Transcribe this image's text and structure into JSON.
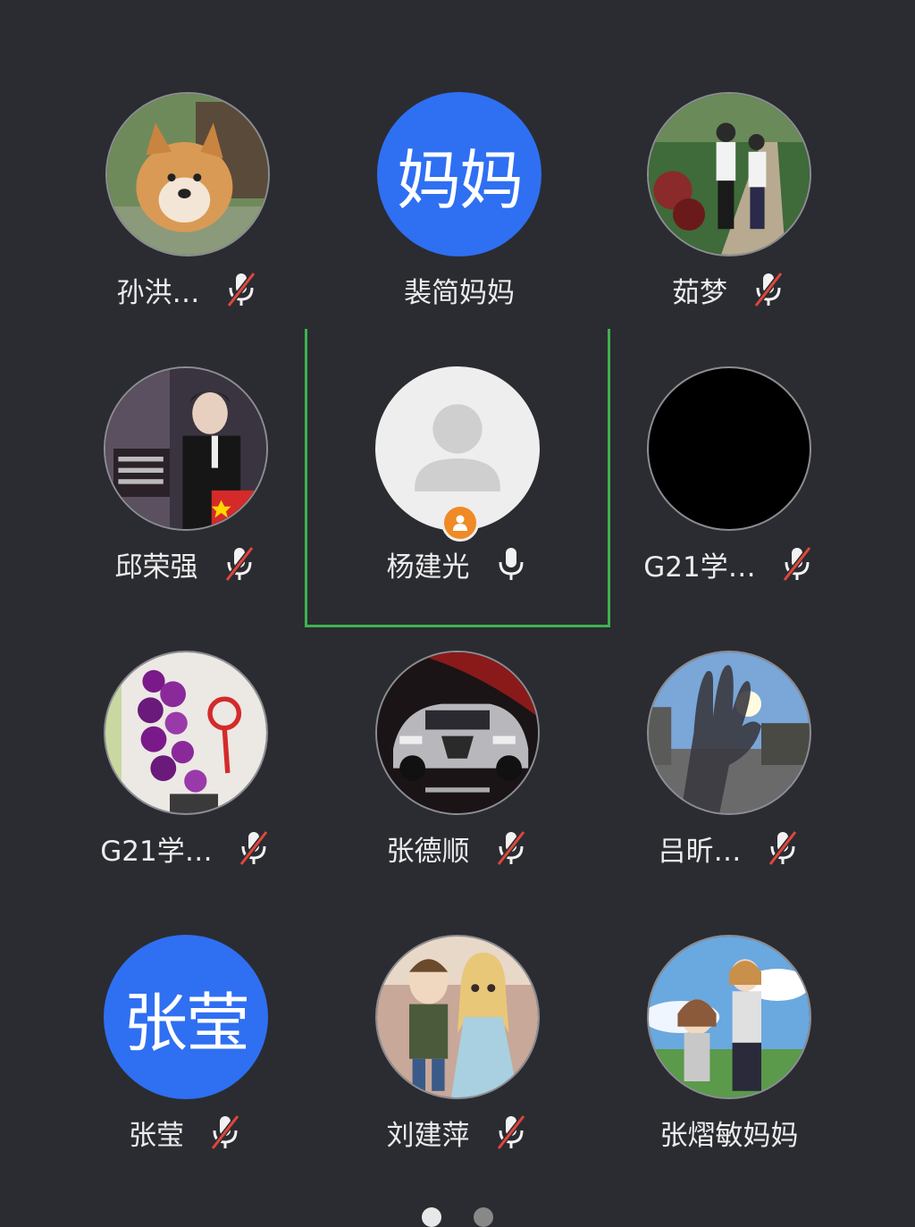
{
  "participants": [
    {
      "name": "孙洪…",
      "avatar_type": "photo",
      "avatar_subject": "dog",
      "muted": true
    },
    {
      "name": "裴简妈妈",
      "avatar_type": "text",
      "avatar_text": "妈妈",
      "muted": null
    },
    {
      "name": "茹梦",
      "avatar_type": "photo",
      "avatar_subject": "two-people-walking",
      "muted": true
    },
    {
      "name": "邱荣强",
      "avatar_type": "photo",
      "avatar_subject": "man-in-suit",
      "muted": true
    },
    {
      "name": "杨建光",
      "avatar_type": "default",
      "host": true,
      "muted": false,
      "speaking": true
    },
    {
      "name": "G21学…",
      "avatar_type": "black",
      "muted": true
    },
    {
      "name": "G21学…",
      "avatar_type": "photo",
      "avatar_subject": "purple-orchids",
      "muted": true
    },
    {
      "name": "张德顺",
      "avatar_type": "photo",
      "avatar_subject": "car",
      "muted": true
    },
    {
      "name": "吕昕…",
      "avatar_type": "photo",
      "avatar_subject": "hand-sky",
      "muted": true
    },
    {
      "name": "张莹",
      "avatar_type": "text",
      "avatar_text": "张莹",
      "muted": true
    },
    {
      "name": "刘建萍",
      "avatar_type": "photo",
      "avatar_subject": "dolls",
      "muted": true
    },
    {
      "name": "张熠敏妈妈",
      "avatar_type": "photo",
      "avatar_subject": "cartoon-family",
      "muted": null
    }
  ],
  "colors": {
    "background": "#2b2c31",
    "text_avatar": "#2f6ff2",
    "active_speaker_frame": "#3fb24f",
    "muted_slash": "#e0463a",
    "host_badge": "#f08a24"
  },
  "pager": {
    "pages": 2,
    "current": 1
  }
}
